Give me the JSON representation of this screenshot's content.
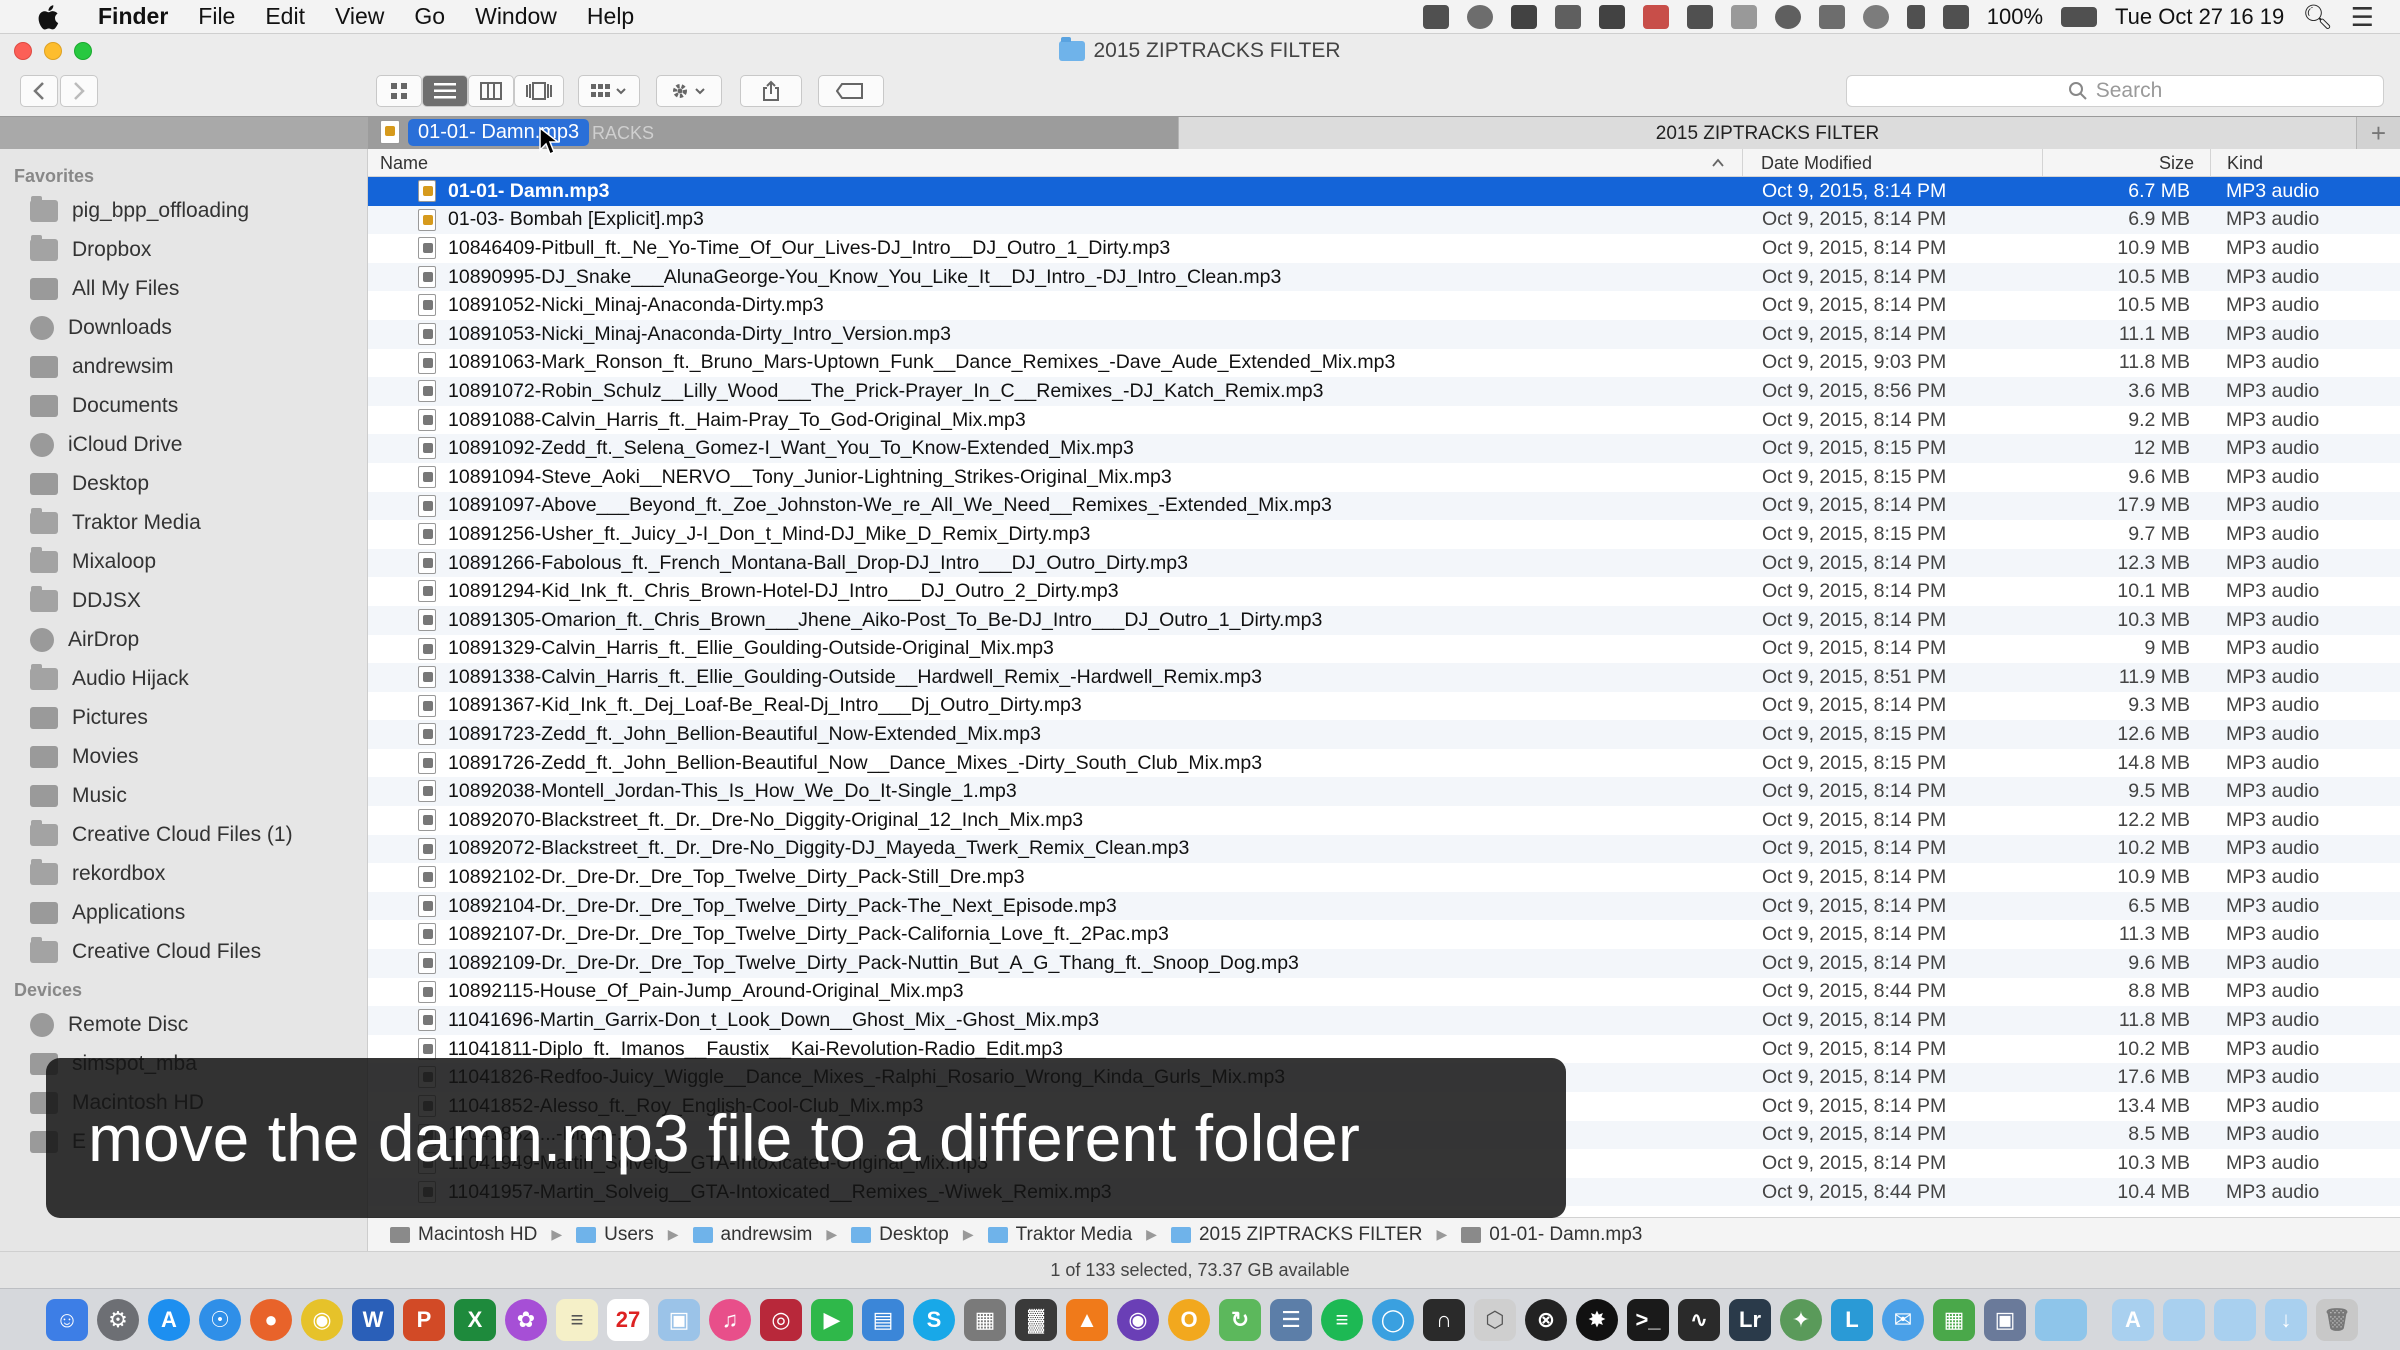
{
  "menubar": {
    "app": "Finder",
    "items": [
      "File",
      "Edit",
      "View",
      "Go",
      "Window",
      "Help"
    ],
    "battery": "100%",
    "clock": "Tue Oct 27  16 19"
  },
  "window": {
    "title": "2015 ZIPTRACKS FILTER",
    "search_placeholder": "Search",
    "tab_left_partial": "RACKS",
    "tab_right": "2015 ZIPTRACKS FILTER",
    "tab_plus": "+",
    "drag_label": "01-01- Damn.mp3"
  },
  "sidebar": {
    "favorites_title": "Favorites",
    "favorites": [
      {
        "label": "pig_bpp_offloading",
        "icon": "folder-icon"
      },
      {
        "label": "Dropbox",
        "icon": "folder-icon"
      },
      {
        "label": "All My Files",
        "icon": "all-files-icon"
      },
      {
        "label": "Downloads",
        "icon": "downloads-icon"
      },
      {
        "label": "andrewsim",
        "icon": "home-icon"
      },
      {
        "label": "Documents",
        "icon": "documents-icon"
      },
      {
        "label": "iCloud Drive",
        "icon": "cloud-icon"
      },
      {
        "label": "Desktop",
        "icon": "desktop-icon"
      },
      {
        "label": "Traktor Media",
        "icon": "folder-icon"
      },
      {
        "label": "Mixaloop",
        "icon": "folder-icon"
      },
      {
        "label": "DDJSX",
        "icon": "folder-icon"
      },
      {
        "label": "AirDrop",
        "icon": "airdrop-icon"
      },
      {
        "label": "Audio Hijack",
        "icon": "folder-icon"
      },
      {
        "label": "Pictures",
        "icon": "pictures-icon"
      },
      {
        "label": "Movies",
        "icon": "movies-icon"
      },
      {
        "label": "Music",
        "icon": "music-icon"
      },
      {
        "label": "Creative Cloud Files (1)",
        "icon": "folder-icon"
      },
      {
        "label": "rekordbox",
        "icon": "folder-icon"
      },
      {
        "label": "Applications",
        "icon": "applications-icon"
      },
      {
        "label": "Creative Cloud Files",
        "icon": "folder-icon"
      }
    ],
    "devices_title": "Devices",
    "devices": [
      {
        "label": "Remote Disc",
        "icon": "disc-icon"
      },
      {
        "label": "simspot_mba",
        "icon": "computer-icon"
      },
      {
        "label": "Macintosh HD",
        "icon": "drive-icon"
      },
      {
        "label": "E",
        "icon": "drive-icon"
      }
    ]
  },
  "columns": {
    "name": "Name",
    "date": "Date Modified",
    "size": "Size",
    "kind": "Kind"
  },
  "files": [
    {
      "name": "01-01- Damn.mp3",
      "date": "Oct 9, 2015, 8:14 PM",
      "size": "6.7 MB",
      "kind": "MP3 audio",
      "art": true
    },
    {
      "name": "01-03- Bombah [Explicit].mp3",
      "date": "Oct 9, 2015, 8:14 PM",
      "size": "6.9 MB",
      "kind": "MP3 audio",
      "art": true
    },
    {
      "name": "10846409-Pitbull_ft._Ne_Yo-Time_Of_Our_Lives-DJ_Intro__DJ_Outro_1_Dirty.mp3",
      "date": "Oct 9, 2015, 8:14 PM",
      "size": "10.9 MB",
      "kind": "MP3 audio"
    },
    {
      "name": "10890995-DJ_Snake___AlunaGeorge-You_Know_You_Like_It__DJ_Intro_-DJ_Intro_Clean.mp3",
      "date": "Oct 9, 2015, 8:14 PM",
      "size": "10.5 MB",
      "kind": "MP3 audio"
    },
    {
      "name": "10891052-Nicki_Minaj-Anaconda-Dirty.mp3",
      "date": "Oct 9, 2015, 8:14 PM",
      "size": "10.5 MB",
      "kind": "MP3 audio"
    },
    {
      "name": "10891053-Nicki_Minaj-Anaconda-Dirty_Intro_Version.mp3",
      "date": "Oct 9, 2015, 8:14 PM",
      "size": "11.1 MB",
      "kind": "MP3 audio"
    },
    {
      "name": "10891063-Mark_Ronson_ft._Bruno_Mars-Uptown_Funk__Dance_Remixes_-Dave_Aude_Extended_Mix.mp3",
      "date": "Oct 9, 2015, 9:03 PM",
      "size": "11.8 MB",
      "kind": "MP3 audio"
    },
    {
      "name": "10891072-Robin_Schulz__Lilly_Wood___The_Prick-Prayer_In_C__Remixes_-DJ_Katch_Remix.mp3",
      "date": "Oct 9, 2015, 8:56 PM",
      "size": "3.6 MB",
      "kind": "MP3 audio"
    },
    {
      "name": "10891088-Calvin_Harris_ft._Haim-Pray_To_God-Original_Mix.mp3",
      "date": "Oct 9, 2015, 8:14 PM",
      "size": "9.2 MB",
      "kind": "MP3 audio"
    },
    {
      "name": "10891092-Zedd_ft._Selena_Gomez-I_Want_You_To_Know-Extended_Mix.mp3",
      "date": "Oct 9, 2015, 8:15 PM",
      "size": "12 MB",
      "kind": "MP3 audio"
    },
    {
      "name": "10891094-Steve_Aoki__NERVO__Tony_Junior-Lightning_Strikes-Original_Mix.mp3",
      "date": "Oct 9, 2015, 8:15 PM",
      "size": "9.6 MB",
      "kind": "MP3 audio"
    },
    {
      "name": "10891097-Above___Beyond_ft._Zoe_Johnston-We_re_All_We_Need__Remixes_-Extended_Mix.mp3",
      "date": "Oct 9, 2015, 8:14 PM",
      "size": "17.9 MB",
      "kind": "MP3 audio"
    },
    {
      "name": "10891256-Usher_ft._Juicy_J-I_Don_t_Mind-DJ_Mike_D_Remix_Dirty.mp3",
      "date": "Oct 9, 2015, 8:15 PM",
      "size": "9.7 MB",
      "kind": "MP3 audio"
    },
    {
      "name": "10891266-Fabolous_ft._French_Montana-Ball_Drop-DJ_Intro___DJ_Outro_Dirty.mp3",
      "date": "Oct 9, 2015, 8:14 PM",
      "size": "12.3 MB",
      "kind": "MP3 audio"
    },
    {
      "name": "10891294-Kid_Ink_ft._Chris_Brown-Hotel-DJ_Intro___DJ_Outro_2_Dirty.mp3",
      "date": "Oct 9, 2015, 8:14 PM",
      "size": "10.1 MB",
      "kind": "MP3 audio"
    },
    {
      "name": "10891305-Omarion_ft._Chris_Brown___Jhene_Aiko-Post_To_Be-DJ_Intro___DJ_Outro_1_Dirty.mp3",
      "date": "Oct 9, 2015, 8:14 PM",
      "size": "10.3 MB",
      "kind": "MP3 audio"
    },
    {
      "name": "10891329-Calvin_Harris_ft._Ellie_Goulding-Outside-Original_Mix.mp3",
      "date": "Oct 9, 2015, 8:14 PM",
      "size": "9 MB",
      "kind": "MP3 audio"
    },
    {
      "name": "10891338-Calvin_Harris_ft._Ellie_Goulding-Outside__Hardwell_Remix_-Hardwell_Remix.mp3",
      "date": "Oct 9, 2015, 8:51 PM",
      "size": "11.9 MB",
      "kind": "MP3 audio"
    },
    {
      "name": "10891367-Kid_Ink_ft._Dej_Loaf-Be_Real-Dj_Intro___Dj_Outro_Dirty.mp3",
      "date": "Oct 9, 2015, 8:14 PM",
      "size": "9.3 MB",
      "kind": "MP3 audio"
    },
    {
      "name": "10891723-Zedd_ft._John_Bellion-Beautiful_Now-Extended_Mix.mp3",
      "date": "Oct 9, 2015, 8:15 PM",
      "size": "12.6 MB",
      "kind": "MP3 audio"
    },
    {
      "name": "10891726-Zedd_ft._John_Bellion-Beautiful_Now__Dance_Mixes_-Dirty_South_Club_Mix.mp3",
      "date": "Oct 9, 2015, 8:15 PM",
      "size": "14.8 MB",
      "kind": "MP3 audio"
    },
    {
      "name": "10892038-Montell_Jordan-This_Is_How_We_Do_It-Single_1.mp3",
      "date": "Oct 9, 2015, 8:14 PM",
      "size": "9.5 MB",
      "kind": "MP3 audio"
    },
    {
      "name": "10892070-Blackstreet_ft._Dr._Dre-No_Diggity-Original_12_Inch_Mix.mp3",
      "date": "Oct 9, 2015, 8:14 PM",
      "size": "12.2 MB",
      "kind": "MP3 audio"
    },
    {
      "name": "10892072-Blackstreet_ft._Dr._Dre-No_Diggity-DJ_Mayeda_Twerk_Remix_Clean.mp3",
      "date": "Oct 9, 2015, 8:14 PM",
      "size": "10.2 MB",
      "kind": "MP3 audio"
    },
    {
      "name": "10892102-Dr._Dre-Dr._Dre_Top_Twelve_Dirty_Pack-Still_Dre.mp3",
      "date": "Oct 9, 2015, 8:14 PM",
      "size": "10.9 MB",
      "kind": "MP3 audio"
    },
    {
      "name": "10892104-Dr._Dre-Dr._Dre_Top_Twelve_Dirty_Pack-The_Next_Episode.mp3",
      "date": "Oct 9, 2015, 8:14 PM",
      "size": "6.5 MB",
      "kind": "MP3 audio"
    },
    {
      "name": "10892107-Dr._Dre-Dr._Dre_Top_Twelve_Dirty_Pack-California_Love_ft._2Pac.mp3",
      "date": "Oct 9, 2015, 8:14 PM",
      "size": "11.3 MB",
      "kind": "MP3 audio"
    },
    {
      "name": "10892109-Dr._Dre-Dr._Dre_Top_Twelve_Dirty_Pack-Nuttin_But_A_G_Thang_ft._Snoop_Dog.mp3",
      "date": "Oct 9, 2015, 8:14 PM",
      "size": "9.6 MB",
      "kind": "MP3 audio"
    },
    {
      "name": "10892115-House_Of_Pain-Jump_Around-Original_Mix.mp3",
      "date": "Oct 9, 2015, 8:44 PM",
      "size": "8.8 MB",
      "kind": "MP3 audio"
    },
    {
      "name": "11041696-Martin_Garrix-Don_t_Look_Down__Ghost_Mix_-Ghost_Mix.mp3",
      "date": "Oct 9, 2015, 8:14 PM",
      "size": "11.8 MB",
      "kind": "MP3 audio"
    },
    {
      "name": "11041811-Diplo_ft._Imanos__Faustix__Kai-Revolution-Radio_Edit.mp3",
      "date": "Oct 9, 2015, 8:14 PM",
      "size": "10.2 MB",
      "kind": "MP3 audio"
    },
    {
      "name": "11041826-Redfoo-Juicy_Wiggle__Dance_Mixes_-Ralphi_Rosario_Wrong_Kinda_Gurls_Mix.mp3",
      "date": "Oct 9, 2015, 8:14 PM",
      "size": "17.6 MB",
      "kind": "MP3 audio"
    },
    {
      "name": "11041852-Alesso_ft._Roy_English-Cool-Club_Mix.mp3",
      "date": "Oct 9, 2015, 8:14 PM",
      "size": "13.4 MB",
      "kind": "MP3 audio"
    },
    {
      "name": "11041882-...-Black-...",
      "date": "Oct 9, 2015, 8:14 PM",
      "size": "8.5 MB",
      "kind": "MP3 audio"
    },
    {
      "name": "11041949-Martin_Solveig__GTA-Intoxicated-Original_Mix.mp3",
      "date": "Oct 9, 2015, 8:14 PM",
      "size": "10.3 MB",
      "kind": "MP3 audio"
    },
    {
      "name": "11041957-Martin_Solveig__GTA-Intoxicated__Remixes_-Wiwek_Remix.mp3",
      "date": "Oct 9, 2015, 8:44 PM",
      "size": "10.4 MB",
      "kind": "MP3 audio"
    }
  ],
  "pathbar": [
    "Macintosh HD",
    "Users",
    "andrewsim",
    "Desktop",
    "Traktor Media",
    "2015 ZIPTRACKS FILTER",
    "01-01- Damn.mp3"
  ],
  "status": "1 of 133 selected, 73.37 GB available",
  "caption": "move the damn.mp3 file to a different folder",
  "colors": {
    "selection": "#1464d8",
    "folder": "#6fb3ea"
  }
}
